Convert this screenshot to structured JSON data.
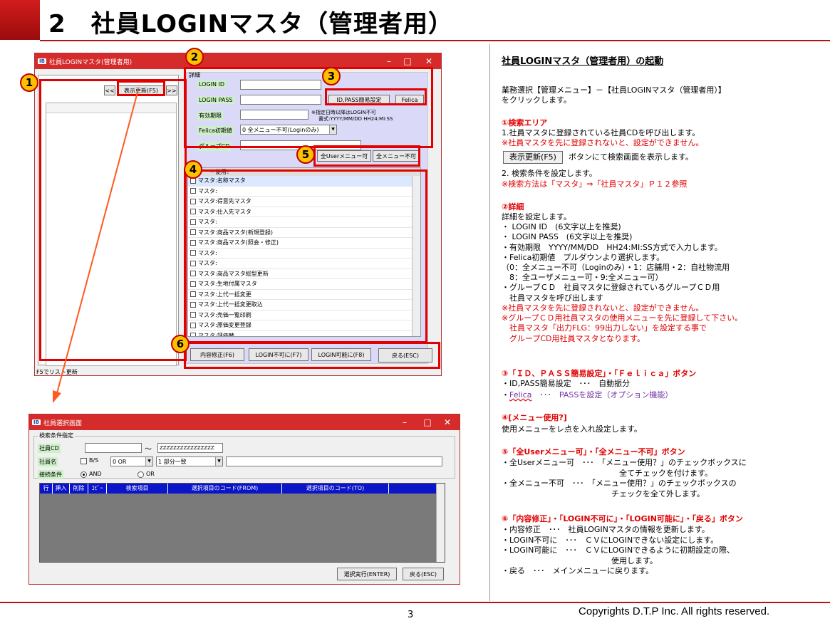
{
  "header": {
    "title": "2　社員LOGINマスタ（管理者用）",
    "page_number": "3",
    "copyright": "Copyrights  D.T.P Inc. All rights reserved."
  },
  "badges": [
    "1",
    "2",
    "3",
    "4",
    "5",
    "6"
  ],
  "win1": {
    "icon": "IB",
    "title": "社員LOGINマスタ(管理者用)",
    "controls": {
      "minimize": "–",
      "maximize": "□",
      "close": "✕"
    },
    "prev": "<<",
    "refresh": "表示更新(F5)",
    "next": ">>",
    "status": "F5でリスト更新",
    "detail_group": "詳細",
    "login_id_label": "LOGIN ID",
    "login_pass_label": "LOGIN PASS",
    "expiry_label": "有効期限",
    "expiry_note1": "※指定日時以降はLOGIN不可",
    "expiry_note2": "書式:YYYY/MM/DD HH24:MI:SS",
    "felica_label": "Felica初期値",
    "felica_value": "0 全メニュー不可(Loginのみ)",
    "group_label": "グループCD",
    "idpass_btn": "ID,PASS簡易設定",
    "felica_btn": "Felica",
    "all_user_btn": "全Userメニュー可",
    "all_none_btn": "全メニュー不可",
    "menu_header": "ー使用？",
    "menu_items": [
      "マスタ:名称マスタ",
      "マスタ:",
      "マスタ:得意先マスタ",
      "マスタ:仕入先マスタ",
      "マスタ:",
      "マスタ:商品マスタ(新規登録)",
      "マスタ:商品マスタ(照会・修正)",
      "マスタ:",
      "マスタ:",
      "マスタ:商品マスタ総型更新",
      "マスタ:生地付属マスタ",
      "マスタ:上代一括変更",
      "マスタ:上代一括変更取込",
      "マスタ:売価一覧印刷",
      "マスタ:原価変更登録",
      "マスタ:評価替"
    ],
    "update_btn": "内容修正(F6)",
    "login_ng_btn": "LOGIN不可に(F7)",
    "login_ok_btn": "LOGIN可能に(F8)",
    "back_btn": "戻る(ESC)"
  },
  "win2": {
    "icon": "IB",
    "title": "社員選択画面",
    "controls": {
      "minimize": "–",
      "maximize": "□",
      "close": "✕"
    },
    "group": "検索条件指定",
    "cd_label": "社員CD",
    "tilde": "～",
    "cd_to": "ZZZZZZZZZZZZZZZZ",
    "name_label": "社員名",
    "bs_label": "B/S",
    "or_value": "0 OR",
    "match_value": "1 部分一致",
    "join_label": "接続条件",
    "and_label": "AND",
    "or_label": "OR",
    "columns": [
      "行",
      "挿入",
      "削除",
      "ｺﾋﾟｰ",
      "検索項目",
      "選択項目のコード(FROM)",
      "選択項目のコード(TO)"
    ],
    "exec_btn": "選択実行(ENTER)",
    "back_btn": "戻る(ESC)"
  },
  "explain": {
    "heading": "社員LOGINマスタ（管理者用）の起動",
    "intro1": "業務選択【管理メニュー】－【社員LOGINマスタ（管理者用）】",
    "intro2": "をクリックします。",
    "s1_title": "①検索エリア",
    "s1_l1": "1.社員マスタに登録されている社員CDを呼び出します。",
    "s1_l2": "※社員マスタを先に登録されないと、設定ができません。",
    "s1_btn": "表示更新(F5)",
    "s1_l3": "ボタンにて検索画面を表示します。",
    "s1_l4": "2. 検索条件を設定します。",
    "s1_l5": "※検索方法は「マスタ」⇒「社員マスタ」Ｐ１２参照",
    "s2_title": "②詳細",
    "s2_lines": [
      " 詳細を設定します。",
      "・ LOGIN ID　(6文字以上を推奨)",
      "・ LOGIN PASS　(6文字以上を推奨)",
      "・有効期限　YYYY/MM/DD　HH24:MI:SS方式で入力します。",
      "・Felica初期値　プルダウンより選択します。",
      "（0：全メニュー不可（Loginのみ）・1：店舗用・2：自社物流用",
      "　8：全ユーザメニュー可・9:全メニュー可）",
      "・グループＣＤ　社員マスタに登録されているグループＣＤ用",
      "　社員マスタを呼び出します"
    ],
    "s2_red": [
      "※社員マスタを先に登録されないと、設定ができません。",
      "※グループＣＤ用社員マスタの使用メニューを先に登録して下さい。",
      "　社員マスタ「出力FLG：99出力しない」を設定する事で",
      "　グループCD用社員マスタとなります。"
    ],
    "s3_title": "③「ＩＤ、ＰＡＳＳ簡易設定」・「Ｆｅｌｉｃａ」ボタン",
    "s3_l1": "・ID,PASS簡易設定　･･･　自動振分",
    "s3_l2_a": "・",
    "s3_l2_b": "Felica",
    "s3_l2_c": "　･･･　PASSを設定（オプション機能）",
    "s4_title": "④[メニュー使用?]",
    "s4_l1": "使用メニューをレ点を入れ設定します。",
    "s5_title": "⑤「全Userメニュー可」・「全メニュー不可」ボタン",
    "s5_lines": [
      "・全Userメニュー可　･･･　「メニュー使用？」のチェックボックスに",
      "　　　　　　　　　　　　　　　全てチェックを付けます。",
      "・全メニュー不可　･･･　「メニュー使用？」のチェックボックスの",
      "　　　　　　　　　　　　　　チェックを全て外します。"
    ],
    "s6_title": "⑥「内容修正」・「LOGIN不可に」・「LOGIN可能に」・「戻る」ボタン",
    "s6_lines": [
      "・内容修正　･･･　社員LOGINマスタの情報を更新します。",
      "・LOGIN不可に　･･･　ＣＶにLOGINできない設定にします。",
      "・LOGIN可能に　･･･　ＣＶにLOGINできるように初期設定の際、",
      "　　　　　　　　　　　　　　使用します。",
      "・戻る　･･･　メインメニューに戻ります。"
    ]
  }
}
